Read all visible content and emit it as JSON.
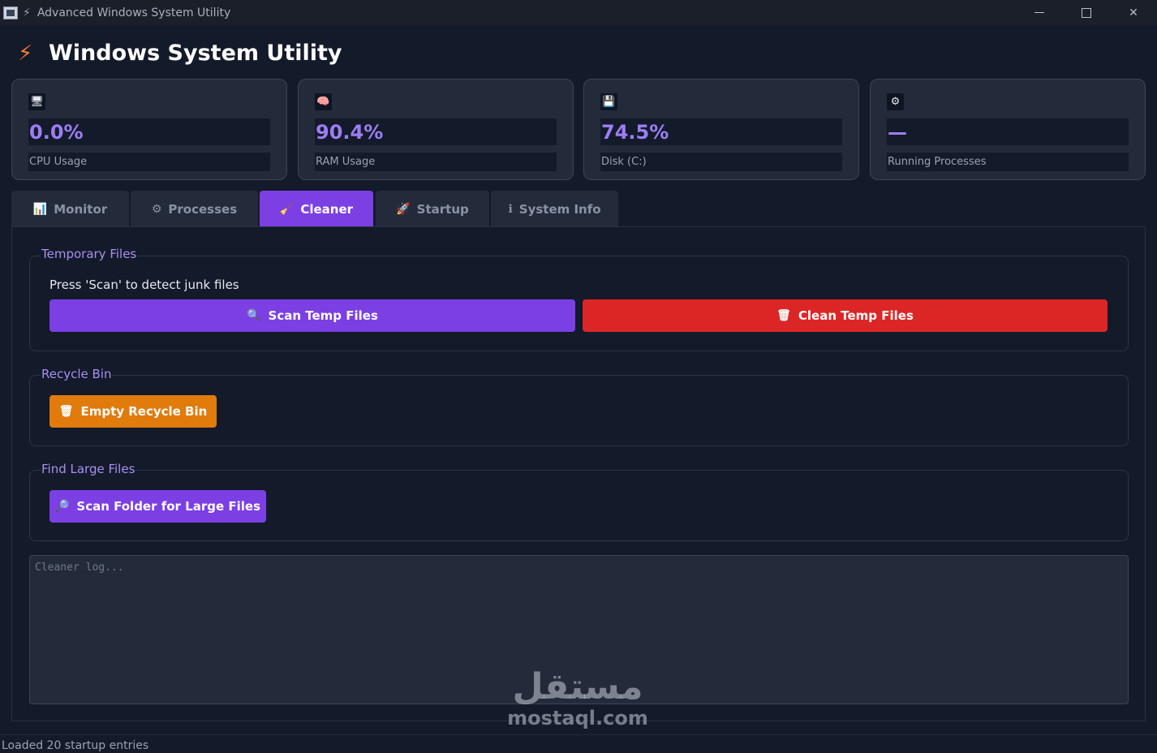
{
  "window": {
    "title": "Advanced Windows System Utility",
    "app_icon": "app-window-icon",
    "bolt_icon": "lightning-icon"
  },
  "header": {
    "icon": "lightning-icon",
    "title": "Windows System Utility"
  },
  "stats": [
    {
      "icon": "monitor-icon",
      "glyph": "🖥",
      "value": "0.0%",
      "label": "CPU Usage"
    },
    {
      "icon": "brain-icon",
      "glyph": "🧠",
      "value": "90.4%",
      "label": "RAM Usage"
    },
    {
      "icon": "floppy-disk-icon",
      "glyph": "💾",
      "value": "74.5%",
      "label": "Disk (C:)"
    },
    {
      "icon": "gear-icon",
      "glyph": "⚙",
      "value": "—",
      "label": "Running Processes"
    }
  ],
  "tabs": [
    {
      "glyph": "📊",
      "label": "Monitor",
      "icon": "bar-chart-icon"
    },
    {
      "glyph": "⚙",
      "label": "Processes",
      "icon": "gear-icon"
    },
    {
      "glyph": "🧹",
      "label": "Cleaner",
      "icon": "broom-icon",
      "active": true
    },
    {
      "glyph": "🚀",
      "label": "Startup",
      "icon": "rocket-icon"
    },
    {
      "glyph": "ℹ",
      "label": "System Info",
      "icon": "info-icon"
    }
  ],
  "cleaner": {
    "temp_group_title": "Temporary Files",
    "temp_hint": "Press 'Scan' to detect junk files",
    "scan_temp_label": "Scan Temp Files",
    "scan_temp_glyph": "🔍",
    "clean_temp_label": "Clean Temp Files",
    "clean_temp_glyph": "🗑",
    "recycle_group_title": "Recycle Bin",
    "empty_recycle_label": "Empty Recycle Bin",
    "empty_recycle_glyph": "🗑",
    "large_group_title": "Find Large Files",
    "scan_large_label": "Scan Folder for Large Files",
    "scan_large_glyph": "🔎",
    "log_placeholder": "Cleaner log..."
  },
  "status": {
    "text": "Loaded 20 startup entries"
  },
  "watermark": {
    "arabic": "مستقل",
    "latin": "mostaql.com"
  },
  "colors": {
    "accent": "#7b3fe4",
    "value_text": "#9d7df5",
    "danger": "#dc2626",
    "warning": "#e07b0c",
    "background": "#131a2a",
    "card": "#232b3b"
  }
}
